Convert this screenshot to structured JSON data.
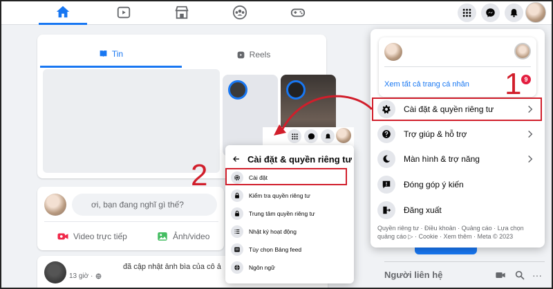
{
  "colors": {
    "accent": "#1877f2",
    "annotation_red": "#d11e2b",
    "badge_red": "#e41e3f"
  },
  "topnav": {
    "tabs": [
      {
        "icon": "home-icon",
        "active": true
      },
      {
        "icon": "video-icon",
        "active": false
      },
      {
        "icon": "marketplace-icon",
        "active": false
      },
      {
        "icon": "groups-icon",
        "active": false
      },
      {
        "icon": "gaming-icon",
        "active": false
      }
    ],
    "actions": [
      "menu-grid-icon",
      "messenger-icon",
      "notifications-icon"
    ]
  },
  "feed": {
    "tabs": [
      {
        "label": "Tin",
        "icon": "book-icon",
        "active": true
      },
      {
        "label": "Reels",
        "icon": "reels-icon",
        "active": false
      }
    ]
  },
  "composer": {
    "placeholder": "ơi, bạn đang nghĩ gì thế?",
    "actions": [
      {
        "label": "Video trực tiếp",
        "icon": "live-video-icon",
        "color": "#f02849"
      },
      {
        "label": "Ảnh/video",
        "icon": "photo-icon",
        "color": "#45bd62"
      }
    ]
  },
  "post": {
    "text": "đã cập nhật ảnh bìa của cô ả",
    "time": "13 giờ ·"
  },
  "right": {
    "contacts_title": "Người liên hệ"
  },
  "dropdown": {
    "profile_link": "Xem tất cả trang cá nhân",
    "badge": "9",
    "items": [
      {
        "label": "Cài đặt & quyền riêng tư",
        "icon": "gear-icon",
        "chevron": true
      },
      {
        "label": "Trợ giúp & hỗ trợ",
        "icon": "help-icon",
        "chevron": true
      },
      {
        "label": "Màn hình & trợ năng",
        "icon": "moon-icon",
        "chevron": true
      },
      {
        "label": "Đóng góp ý kiến",
        "icon": "feedback-icon",
        "chevron": false
      },
      {
        "label": "Đăng xuất",
        "icon": "logout-icon",
        "chevron": false
      }
    ],
    "footer": "Quyền riêng tư · Điều khoản · Quảng cáo · Lựa chọn quảng cáo ▷ · Cookie · Xem thêm · Meta © 2023"
  },
  "submenu": {
    "title": "Cài đặt & quyền riêng tư",
    "items": [
      {
        "label": "Cài đặt",
        "icon": "gear-icon"
      },
      {
        "label": "Kiểm tra quyền riêng tư",
        "icon": "lock-icon"
      },
      {
        "label": "Trung tâm quyền riêng tư",
        "icon": "lock-icon"
      },
      {
        "label": "Nhật ký hoạt động",
        "icon": "list-icon"
      },
      {
        "label": "Tùy chọn Bảng feed",
        "icon": "feed-icon"
      },
      {
        "label": "Ngôn ngữ",
        "icon": "globe-icon"
      }
    ]
  },
  "annotations": {
    "step1": "1",
    "step2": "2"
  }
}
